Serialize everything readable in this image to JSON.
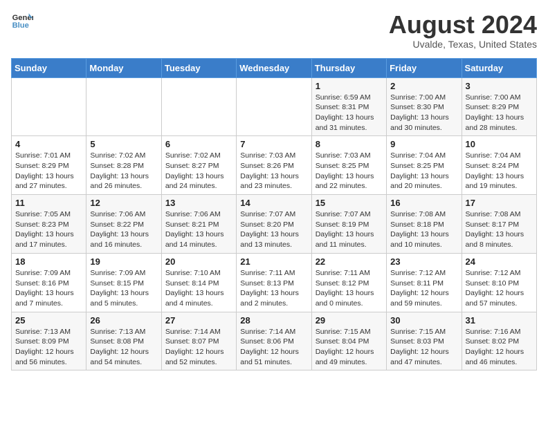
{
  "logo": {
    "line1": "General",
    "line2": "Blue"
  },
  "title": "August 2024",
  "location": "Uvalde, Texas, United States",
  "headers": [
    "Sunday",
    "Monday",
    "Tuesday",
    "Wednesday",
    "Thursday",
    "Friday",
    "Saturday"
  ],
  "weeks": [
    [
      {
        "day": "",
        "info": ""
      },
      {
        "day": "",
        "info": ""
      },
      {
        "day": "",
        "info": ""
      },
      {
        "day": "",
        "info": ""
      },
      {
        "day": "1",
        "info": "Sunrise: 6:59 AM\nSunset: 8:31 PM\nDaylight: 13 hours\nand 31 minutes."
      },
      {
        "day": "2",
        "info": "Sunrise: 7:00 AM\nSunset: 8:30 PM\nDaylight: 13 hours\nand 30 minutes."
      },
      {
        "day": "3",
        "info": "Sunrise: 7:00 AM\nSunset: 8:29 PM\nDaylight: 13 hours\nand 28 minutes."
      }
    ],
    [
      {
        "day": "4",
        "info": "Sunrise: 7:01 AM\nSunset: 8:29 PM\nDaylight: 13 hours\nand 27 minutes."
      },
      {
        "day": "5",
        "info": "Sunrise: 7:02 AM\nSunset: 8:28 PM\nDaylight: 13 hours\nand 26 minutes."
      },
      {
        "day": "6",
        "info": "Sunrise: 7:02 AM\nSunset: 8:27 PM\nDaylight: 13 hours\nand 24 minutes."
      },
      {
        "day": "7",
        "info": "Sunrise: 7:03 AM\nSunset: 8:26 PM\nDaylight: 13 hours\nand 23 minutes."
      },
      {
        "day": "8",
        "info": "Sunrise: 7:03 AM\nSunset: 8:25 PM\nDaylight: 13 hours\nand 22 minutes."
      },
      {
        "day": "9",
        "info": "Sunrise: 7:04 AM\nSunset: 8:25 PM\nDaylight: 13 hours\nand 20 minutes."
      },
      {
        "day": "10",
        "info": "Sunrise: 7:04 AM\nSunset: 8:24 PM\nDaylight: 13 hours\nand 19 minutes."
      }
    ],
    [
      {
        "day": "11",
        "info": "Sunrise: 7:05 AM\nSunset: 8:23 PM\nDaylight: 13 hours\nand 17 minutes."
      },
      {
        "day": "12",
        "info": "Sunrise: 7:06 AM\nSunset: 8:22 PM\nDaylight: 13 hours\nand 16 minutes."
      },
      {
        "day": "13",
        "info": "Sunrise: 7:06 AM\nSunset: 8:21 PM\nDaylight: 13 hours\nand 14 minutes."
      },
      {
        "day": "14",
        "info": "Sunrise: 7:07 AM\nSunset: 8:20 PM\nDaylight: 13 hours\nand 13 minutes."
      },
      {
        "day": "15",
        "info": "Sunrise: 7:07 AM\nSunset: 8:19 PM\nDaylight: 13 hours\nand 11 minutes."
      },
      {
        "day": "16",
        "info": "Sunrise: 7:08 AM\nSunset: 8:18 PM\nDaylight: 13 hours\nand 10 minutes."
      },
      {
        "day": "17",
        "info": "Sunrise: 7:08 AM\nSunset: 8:17 PM\nDaylight: 13 hours\nand 8 minutes."
      }
    ],
    [
      {
        "day": "18",
        "info": "Sunrise: 7:09 AM\nSunset: 8:16 PM\nDaylight: 13 hours\nand 7 minutes."
      },
      {
        "day": "19",
        "info": "Sunrise: 7:09 AM\nSunset: 8:15 PM\nDaylight: 13 hours\nand 5 minutes."
      },
      {
        "day": "20",
        "info": "Sunrise: 7:10 AM\nSunset: 8:14 PM\nDaylight: 13 hours\nand 4 minutes."
      },
      {
        "day": "21",
        "info": "Sunrise: 7:11 AM\nSunset: 8:13 PM\nDaylight: 13 hours\nand 2 minutes."
      },
      {
        "day": "22",
        "info": "Sunrise: 7:11 AM\nSunset: 8:12 PM\nDaylight: 13 hours\nand 0 minutes."
      },
      {
        "day": "23",
        "info": "Sunrise: 7:12 AM\nSunset: 8:11 PM\nDaylight: 12 hours\nand 59 minutes."
      },
      {
        "day": "24",
        "info": "Sunrise: 7:12 AM\nSunset: 8:10 PM\nDaylight: 12 hours\nand 57 minutes."
      }
    ],
    [
      {
        "day": "25",
        "info": "Sunrise: 7:13 AM\nSunset: 8:09 PM\nDaylight: 12 hours\nand 56 minutes."
      },
      {
        "day": "26",
        "info": "Sunrise: 7:13 AM\nSunset: 8:08 PM\nDaylight: 12 hours\nand 54 minutes."
      },
      {
        "day": "27",
        "info": "Sunrise: 7:14 AM\nSunset: 8:07 PM\nDaylight: 12 hours\nand 52 minutes."
      },
      {
        "day": "28",
        "info": "Sunrise: 7:14 AM\nSunset: 8:06 PM\nDaylight: 12 hours\nand 51 minutes."
      },
      {
        "day": "29",
        "info": "Sunrise: 7:15 AM\nSunset: 8:04 PM\nDaylight: 12 hours\nand 49 minutes."
      },
      {
        "day": "30",
        "info": "Sunrise: 7:15 AM\nSunset: 8:03 PM\nDaylight: 12 hours\nand 47 minutes."
      },
      {
        "day": "31",
        "info": "Sunrise: 7:16 AM\nSunset: 8:02 PM\nDaylight: 12 hours\nand 46 minutes."
      }
    ]
  ]
}
